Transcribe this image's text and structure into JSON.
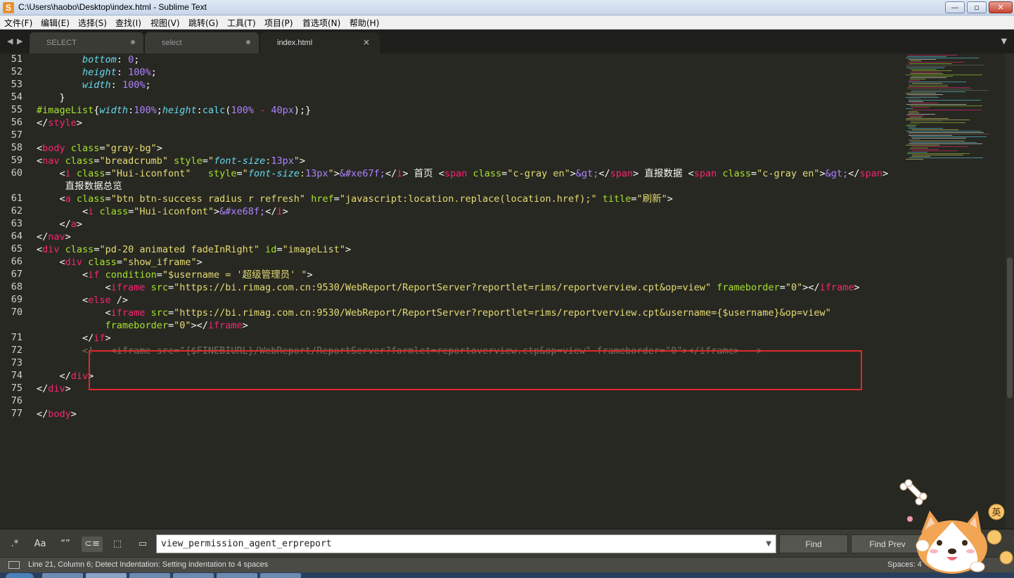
{
  "window": {
    "title": "C:\\Users\\haobo\\Desktop\\index.html - Sublime Text",
    "min": "—",
    "max": "▫",
    "close": "✕"
  },
  "menu": [
    "文件(F)",
    "编辑(E)",
    "选择(S)",
    "查找(I)",
    "视图(V)",
    "跳转(G)",
    "工具(T)",
    "项目(P)",
    "首选项(N)",
    "帮助(H)"
  ],
  "tabs": [
    {
      "label": "SELECT",
      "active": false
    },
    {
      "label": "select",
      "active": false
    },
    {
      "label": "index.html",
      "active": true,
      "close": "×"
    }
  ],
  "editor": {
    "lines": [
      51,
      52,
      53,
      54,
      55,
      56,
      57,
      58,
      59,
      60,
      61,
      62,
      63,
      64,
      65,
      66,
      67,
      68,
      69,
      70,
      71,
      72,
      73,
      74,
      75,
      76,
      77
    ],
    "code": {
      "l51_prop": "bottom",
      "l51_val": "0",
      "l52_prop": "height",
      "l52_val": "100%",
      "l53_prop": "width",
      "l53_val": "100%",
      "l54": "}",
      "l55_sel": "#imageList",
      "l55_p1": "width",
      "l55_v1": "100%",
      "l55_p2": "height",
      "l55_fn": "calc",
      "l55_a": "100%",
      "l55_op": "-",
      "l55_b": "40px",
      "l56_tag": "style",
      "l58_tag": "body",
      "l58_val": "\"gray-bg\"",
      "l59_tag": "nav",
      "l59_val": "\"breadcrumb\"",
      "l59_p": "font-size",
      "l59_n": "13px",
      "l60_tag": "i",
      "l60_cls": "\"Hui-iconfont\"",
      "l60_p": "font-size",
      "l60_n": "13px",
      "l60_ent": "&#xe67f;",
      "l60_t1": "首页",
      "l60_span": "span",
      "l60_spancls": "\"c-gray en\"",
      "l60_gt": "&gt;",
      "l60_t2": "直报数据",
      "l60_t3": "直报数据总览",
      "l61_tag": "a",
      "l61_cls": "\"btn btn-success radius r refresh\"",
      "l61_href": "\"javascript:location.replace(location.href);\"",
      "l61_title": "\"刷新\"",
      "l62_tag": "i",
      "l62_cls": "\"Hui-iconfont\"",
      "l62_ent": "&#xe68f;",
      "l63_tag": "a",
      "l64_tag": "nav",
      "l65_tag": "div",
      "l65_cls": "\"pd-20 animated fadeInRight\"",
      "l65_id": "\"imageList\"",
      "l66_tag": "div",
      "l66_cls": "\"show_iframe\"",
      "l67_tag": "if",
      "l67_attr": "condition",
      "l67_val": "\"$username = '超级管理员' \"",
      "l68_tag": "iframe",
      "l68_src": "\"https://bi.rimag.com.cn:9530/WebReport/ReportServer?reportlet=rims/reportverview.cpt&op=view\"",
      "l68_fb": "\"0\"",
      "l69_tag": "else",
      "l70_tag": "iframe",
      "l70_src": "\"https://bi.rimag.com.cn:9530/WebReport/ReportServer?reportlet=rims/reportverview.cpt&username={$username}&op=view\"",
      "l70_fb": "\"0\"",
      "l71_tag": "if",
      "l72_comment": "<!-- <iframe src=\"{$FINEBIURL}/WebReport/ReportServer?formlet=reportoverview.ctp&op=view\" frameborder=\"0\"></iframe> -->",
      "l74_tag": "div",
      "l75_tag": "div",
      "l77_tag": "body"
    }
  },
  "find": {
    "opt_regex": ".*",
    "opt_case": "Aa",
    "opt_word": "“”",
    "opt_wrap": "⊂≡",
    "opt_selection": "⬚",
    "opt_highlight": "▭",
    "query": "view_permission_agent_erpreport",
    "find_label": "Find",
    "find_prev_label": "Find Prev"
  },
  "status": {
    "text": "Line 21, Column 6; Detect Indentation: Setting indentation to 4 spaces",
    "spaces": "Spaces: 4"
  },
  "mascot": {
    "badge": "英"
  },
  "colors": {
    "bg": "#272822",
    "tag": "#f92672",
    "attr": "#a6e22e",
    "string": "#e6db74",
    "prop": "#66d9ef",
    "number": "#ae81ff",
    "comment": "#75715e",
    "highlight_box": "#e02a2a"
  }
}
